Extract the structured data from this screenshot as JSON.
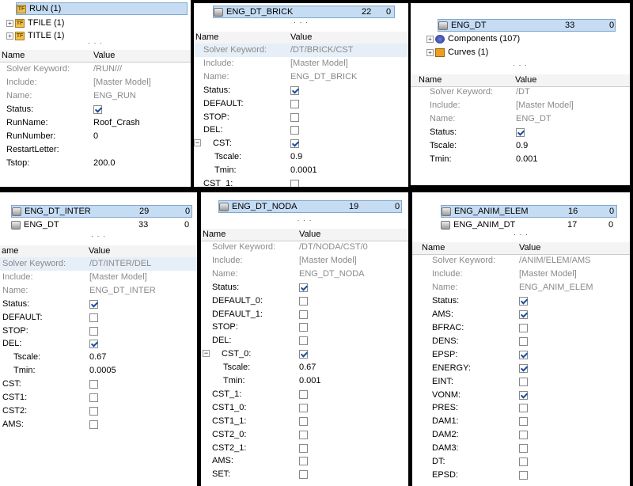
{
  "p1": {
    "tree": [
      {
        "label": "RUN  (1)",
        "selected": true
      },
      {
        "label": "TFILE  (1)",
        "selected": false
      },
      {
        "label": "TITLE  (1)",
        "selected": false
      }
    ],
    "dots": "· · ·",
    "header": {
      "name": "Name",
      "value": "Value"
    },
    "rows": [
      {
        "name": "Solver Keyword:",
        "value": "/RUN///",
        "grey": true
      },
      {
        "name": "Include:",
        "value": "[Master Model]",
        "grey": true
      },
      {
        "name": "Name:",
        "value": "ENG_RUN",
        "grey": true
      },
      {
        "name": "Status:",
        "check": true
      },
      {
        "name": "RunName:",
        "value": "Roof_Crash"
      },
      {
        "name": "RunNumber:",
        "value": "0"
      },
      {
        "name": "RestartLetter:",
        "value": ""
      },
      {
        "name": "Tstop:",
        "value": "200.0"
      }
    ]
  },
  "p2": {
    "tree": [
      {
        "label": "ENG_DT_BRICK",
        "n1": "22",
        "n2": "0",
        "selected": true
      }
    ],
    "dots": "· · ·",
    "header": {
      "name": "Name",
      "value": "Value"
    },
    "rows": [
      {
        "name": "Solver Keyword:",
        "value": "/DT/BRICK/CST",
        "grey": true,
        "hl": true
      },
      {
        "name": "Include:",
        "value": "[Master Model]",
        "grey": true
      },
      {
        "name": "Name:",
        "value": "ENG_DT_BRICK",
        "grey": true
      },
      {
        "name": "Status:",
        "check": true
      },
      {
        "name": "DEFAULT:",
        "check": false
      },
      {
        "name": "STOP:",
        "check": false
      },
      {
        "name": "DEL:",
        "check": false
      },
      {
        "name": "CST:",
        "check": true,
        "group": true
      },
      {
        "name": "Tscale:",
        "value": "0.9",
        "indent": true
      },
      {
        "name": "Tmin:",
        "value": "0.0001",
        "indent": true
      },
      {
        "name": "CST_1:",
        "check": false
      }
    ]
  },
  "p3": {
    "tree": [
      {
        "label": "ENG_DT",
        "n1": "33",
        "n2": "0",
        "selected": true
      },
      {
        "label": "Components (107)",
        "icon": "components"
      },
      {
        "label": "Curves (1)",
        "icon": "curves"
      }
    ],
    "dots": "· · ·",
    "header": {
      "name": "Name",
      "value": "Value"
    },
    "rows": [
      {
        "name": "Solver Keyword:",
        "value": "/DT",
        "grey": true
      },
      {
        "name": "Include:",
        "value": "[Master Model]",
        "grey": true
      },
      {
        "name": "Name:",
        "value": "ENG_DT",
        "grey": true
      },
      {
        "name": "Status:",
        "check": true
      },
      {
        "name": "Tscale:",
        "value": "0.9"
      },
      {
        "name": "Tmin:",
        "value": "0.001"
      }
    ]
  },
  "p4": {
    "tree": [
      {
        "label": "ENG_DT_INTER",
        "n1": "29",
        "n2": "0",
        "selected": true
      },
      {
        "label": "ENG_DT",
        "n1": "33",
        "n2": "0"
      }
    ],
    "dots": "· · ·",
    "header": {
      "name": "ame",
      "value": "Value"
    },
    "rows": [
      {
        "name": "Solver Keyword:",
        "value": "/DT/INTER/DEL",
        "grey": true,
        "hl": true
      },
      {
        "name": "Include:",
        "value": "[Master Model]",
        "grey": true
      },
      {
        "name": "Name:",
        "value": "ENG_DT_INTER",
        "grey": true
      },
      {
        "name": "Status:",
        "check": true
      },
      {
        "name": "DEFAULT:",
        "check": false
      },
      {
        "name": "STOP:",
        "check": false
      },
      {
        "name": "DEL:",
        "check": true
      },
      {
        "name": "Tscale:",
        "value": "0.67",
        "indent": true
      },
      {
        "name": "Tmin:",
        "value": "0.0005",
        "indent": true
      },
      {
        "name": "CST:",
        "check": false
      },
      {
        "name": "CST1:",
        "check": false
      },
      {
        "name": "CST2:",
        "check": false
      },
      {
        "name": "AMS:",
        "check": false
      }
    ]
  },
  "p5": {
    "tree": [
      {
        "label": "ENG_DT_NODA",
        "n1": "19",
        "n2": "0",
        "selected": true
      }
    ],
    "dots": "· · ·",
    "header": {
      "name": "Name",
      "value": "Value"
    },
    "rows": [
      {
        "name": "Solver Keyword:",
        "value": "/DT/NODA/CST/0",
        "grey": true
      },
      {
        "name": "Include:",
        "value": "[Master Model]",
        "grey": true
      },
      {
        "name": "Name:",
        "value": "ENG_DT_NODA",
        "grey": true
      },
      {
        "name": "Status:",
        "check": true
      },
      {
        "name": "DEFAULT_0:",
        "check": false
      },
      {
        "name": "DEFAULT_1:",
        "check": false
      },
      {
        "name": "STOP:",
        "check": false
      },
      {
        "name": "DEL:",
        "check": false
      },
      {
        "name": "CST_0:",
        "check": true,
        "group": true
      },
      {
        "name": "Tscale:",
        "value": "0.67",
        "indent": true
      },
      {
        "name": "Tmin:",
        "value": "0.001",
        "indent": true
      },
      {
        "name": "CST_1:",
        "check": false
      },
      {
        "name": "CST1_0:",
        "check": false
      },
      {
        "name": "CST1_1:",
        "check": false
      },
      {
        "name": "CST2_0:",
        "check": false
      },
      {
        "name": "CST2_1:",
        "check": false
      },
      {
        "name": "AMS:",
        "check": false
      },
      {
        "name": "SET:",
        "check": false
      }
    ]
  },
  "p6": {
    "tree": [
      {
        "label": "ENG_ANIM_ELEM",
        "n1": "16",
        "n2": "0",
        "selected": true
      },
      {
        "label": "ENG_ANIM_DT",
        "n1": "17",
        "n2": "0"
      }
    ],
    "dots": "· · ·",
    "header": {
      "name": "Name",
      "value": "Value"
    },
    "rows": [
      {
        "name": "Solver Keyword:",
        "value": "/ANIM/ELEM/AMS",
        "grey": true
      },
      {
        "name": "Include:",
        "value": "[Master Model]",
        "grey": true
      },
      {
        "name": "Name:",
        "value": "ENG_ANIM_ELEM",
        "grey": true
      },
      {
        "name": "Status:",
        "check": true
      },
      {
        "name": "AMS:",
        "check": true
      },
      {
        "name": "BFRAC:",
        "check": false
      },
      {
        "name": "DENS:",
        "check": false
      },
      {
        "name": "EPSP:",
        "check": true
      },
      {
        "name": "ENERGY:",
        "check": true
      },
      {
        "name": "EINT:",
        "check": false
      },
      {
        "name": "VONM:",
        "check": true
      },
      {
        "name": "PRES:",
        "check": false
      },
      {
        "name": "DAM1:",
        "check": false
      },
      {
        "name": "DAM2:",
        "check": false
      },
      {
        "name": "DAM3:",
        "check": false
      },
      {
        "name": "DT:",
        "check": false
      },
      {
        "name": "EPSD:",
        "check": false
      }
    ]
  }
}
